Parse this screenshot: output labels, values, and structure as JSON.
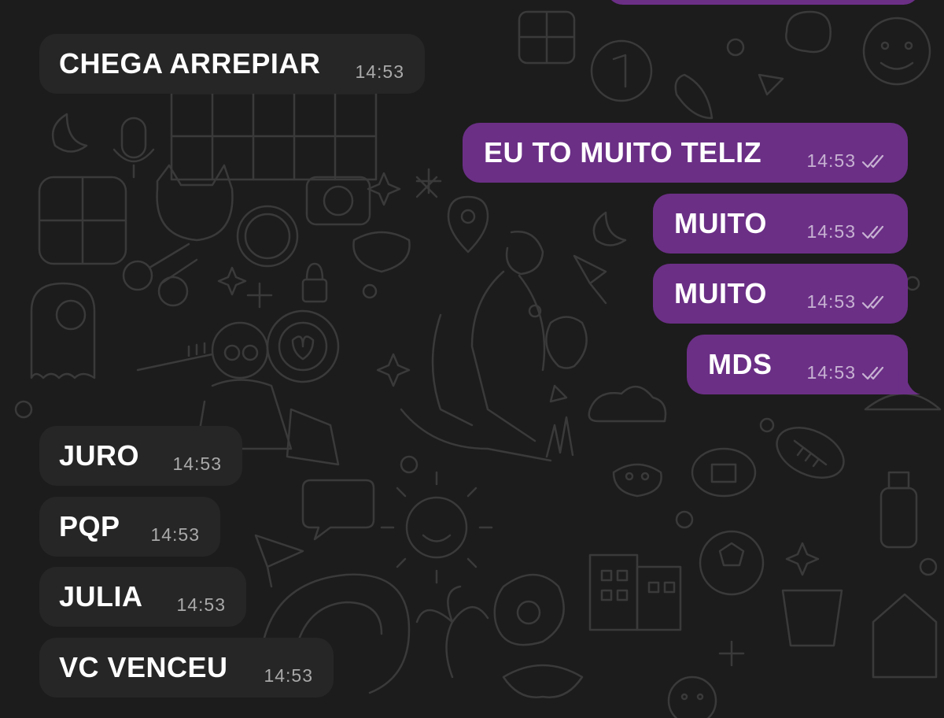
{
  "theme": {
    "background": "#1c1c1c",
    "incoming_bubble": "#262626",
    "outgoing_bubble": "#6b2f86",
    "text": "#ffffff",
    "incoming_time": "#a9a9a9",
    "outgoing_time": "#c7b2d2"
  },
  "messages": [
    {
      "direction": "incoming",
      "text": "CHEGA ARREPIAR",
      "time": "14:53"
    },
    {
      "direction": "outgoing",
      "text": "EU TO MUITO TELIZ",
      "time": "14:53",
      "status_icon": "double-check-icon"
    },
    {
      "direction": "outgoing",
      "text": "MUITO",
      "time": "14:53",
      "status_icon": "double-check-icon"
    },
    {
      "direction": "outgoing",
      "text": "MUITO",
      "time": "14:53",
      "status_icon": "double-check-icon"
    },
    {
      "direction": "outgoing",
      "text": "MDS",
      "time": "14:53",
      "status_icon": "double-check-icon"
    },
    {
      "direction": "incoming",
      "text": "JURO",
      "time": "14:53"
    },
    {
      "direction": "incoming",
      "text": "PQP",
      "time": "14:53"
    },
    {
      "direction": "incoming",
      "text": "JULIA",
      "time": "14:53"
    },
    {
      "direction": "incoming",
      "text": "VC VENCEU",
      "time": "14:53"
    }
  ]
}
